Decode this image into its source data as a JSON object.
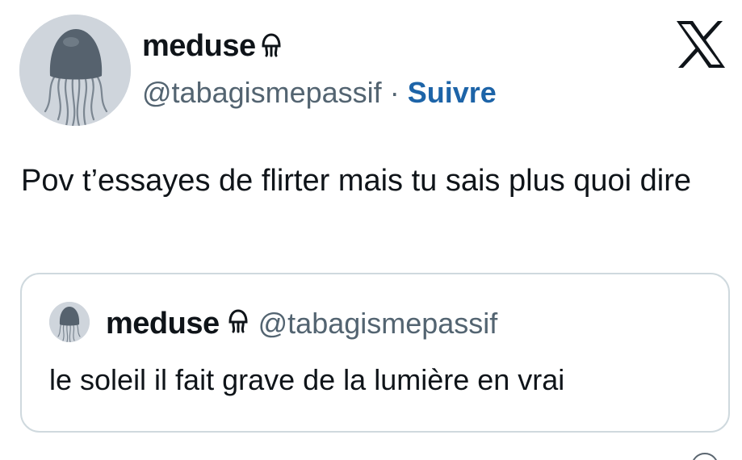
{
  "author": {
    "display_name": "meduse",
    "name_emoji": "jellyfish-icon",
    "handle": "@tabagismepassif",
    "separator": "·",
    "follow_label": "Suivre"
  },
  "tweet": {
    "text": "Pov t’essayes de flirter mais tu sais plus quoi dire"
  },
  "quoted_tweet": {
    "display_name": "meduse",
    "handle": "@tabagismepassif",
    "text": "le soleil il fait grave de la lumière en vrai"
  },
  "colors": {
    "follow": "#1d64a8",
    "secondary_text": "#536471",
    "border": "#cfd9de",
    "avatar_bg": "#cfd5dc"
  }
}
